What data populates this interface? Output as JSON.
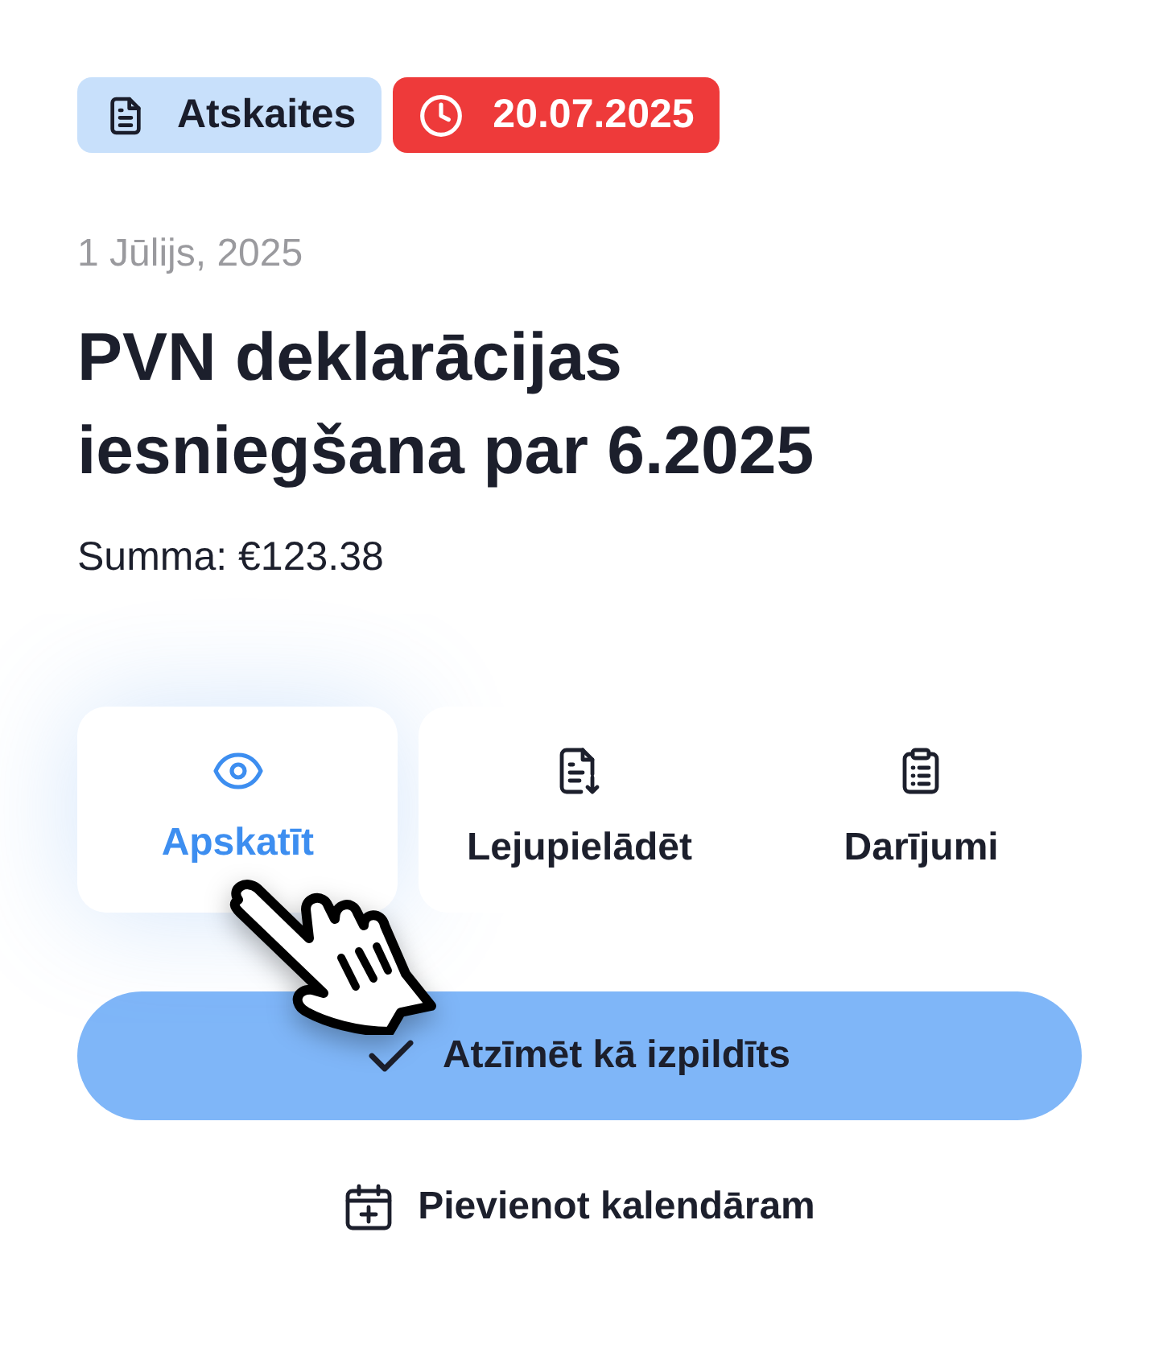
{
  "badges": [
    {
      "kind": "category",
      "label": "Atskaites"
    },
    {
      "kind": "deadline",
      "label": "20.07.2025"
    }
  ],
  "date": "1 Jūlijs, 2025",
  "title": "PVN deklarācijas iesniegšana par 6.2025",
  "amount": "Summa: €123.38",
  "actions": [
    {
      "kind": "view",
      "label": "Apskatīt",
      "selected": true
    },
    {
      "kind": "download",
      "label": "Lejupielādēt",
      "selected": false
    },
    {
      "kind": "transactions",
      "label": "Darījumi",
      "selected": false
    }
  ],
  "primary_button": {
    "label": "Atzīmēt kā izpildīts"
  },
  "calendar_link": {
    "label": "Pievienot kalendāram"
  }
}
